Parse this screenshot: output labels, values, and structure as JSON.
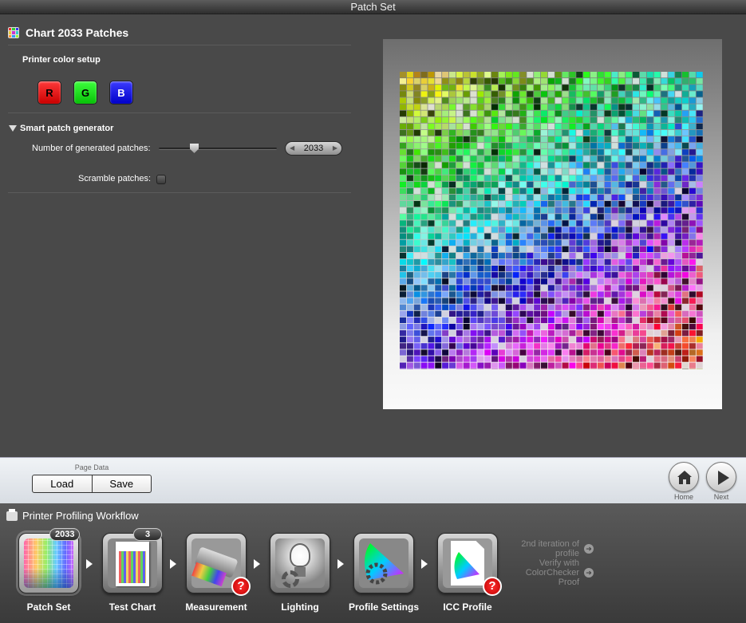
{
  "window": {
    "title": "Patch Set"
  },
  "panel": {
    "chart_title": "Chart 2033 Patches",
    "printer_color_setup_label": "Printer color setup",
    "rgb_buttons": [
      "R",
      "G",
      "B"
    ],
    "smart_generator_label": "Smart patch generator",
    "num_patches_label": "Number of generated patches:",
    "num_patches_value": "2033",
    "scramble_label": "Scramble patches:"
  },
  "preview": {
    "rows": 46,
    "cols": 43,
    "total_patches": 2033
  },
  "toolbar": {
    "page_data_label": "Page Data",
    "load_label": "Load",
    "save_label": "Save",
    "home_label": "Home",
    "next_label": "Next"
  },
  "workflow": {
    "title": "Printer Profiling Workflow",
    "steps": [
      {
        "label": "Patch Set",
        "badge": "2033",
        "warning": false,
        "icon": "patch-set-icon"
      },
      {
        "label": "Test Chart",
        "badge": "3",
        "warning": false,
        "icon": "test-chart-icon"
      },
      {
        "label": "Measurement",
        "badge": "",
        "warning": true,
        "icon": "measurement-icon"
      },
      {
        "label": "Lighting",
        "badge": "",
        "warning": false,
        "icon": "lighting-icon"
      },
      {
        "label": "Profile Settings",
        "badge": "",
        "warning": false,
        "icon": "profile-settings-icon"
      },
      {
        "label": "ICC Profile",
        "badge": "",
        "warning": true,
        "icon": "icc-profile-icon"
      }
    ],
    "second_iteration_text": "2nd iteration of profile",
    "verify_text": "Verify with ColorChecker Proof"
  },
  "colors": {
    "background": "#4a4a4a",
    "red_button": "#e00000",
    "green_button": "#00d000",
    "blue_button": "#0000e0",
    "warning_red": "#d00000"
  }
}
